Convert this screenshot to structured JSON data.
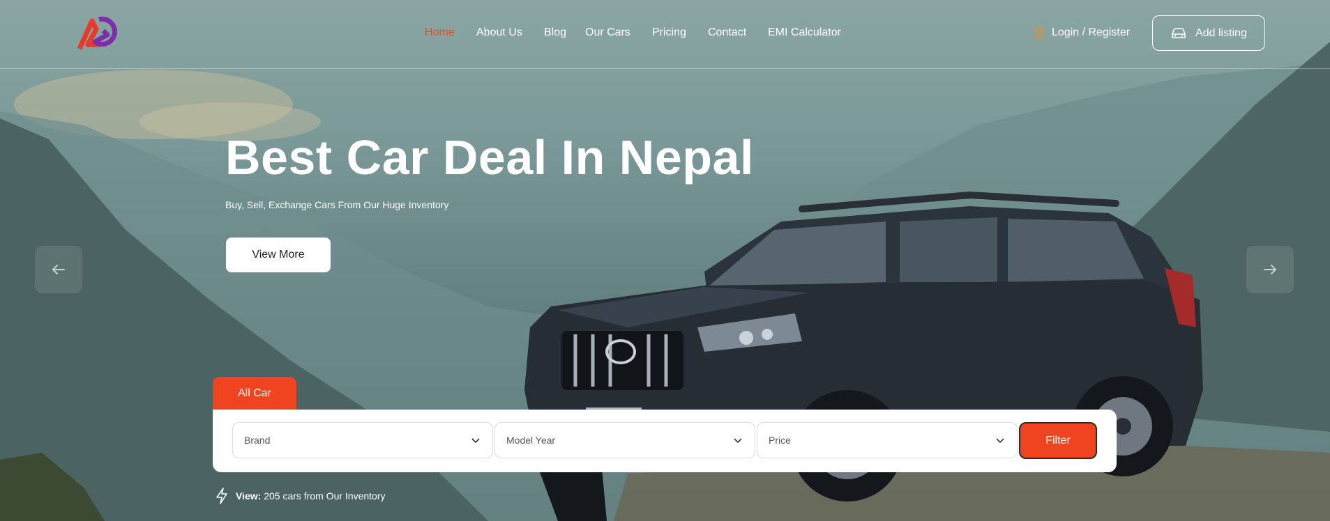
{
  "nav": {
    "items": [
      {
        "label": "Home",
        "active": true
      },
      {
        "label": "About Us"
      },
      {
        "label": "Blog"
      },
      {
        "label": "Our Cars"
      },
      {
        "label": "Pricing"
      },
      {
        "label": "Contact"
      },
      {
        "label": "EMI Calculator"
      }
    ],
    "login_label": "Login / Register",
    "add_listing_label": "Add listing"
  },
  "hero": {
    "title": "Best Car Deal In Nepal",
    "subtitle": "Buy, Sell, Exchange Cars From Our Huge Inventory",
    "cta_label": "View More"
  },
  "search": {
    "tab_label": "All Car",
    "brand_placeholder": "Brand",
    "model_year_placeholder": "Model Year",
    "price_placeholder": "Price",
    "filter_label": "Filter"
  },
  "inventory": {
    "prefix": "View:",
    "text": "205 cars from Our Inventory"
  },
  "colors": {
    "accent": "#f0431f",
    "logo_red": "#e8392a",
    "logo_purple": "#7b2fa8"
  },
  "icons": [
    "logo",
    "user-icon",
    "car-icon",
    "arrow-left-icon",
    "arrow-right-icon",
    "chevron-down-icon",
    "lightning-icon"
  ]
}
